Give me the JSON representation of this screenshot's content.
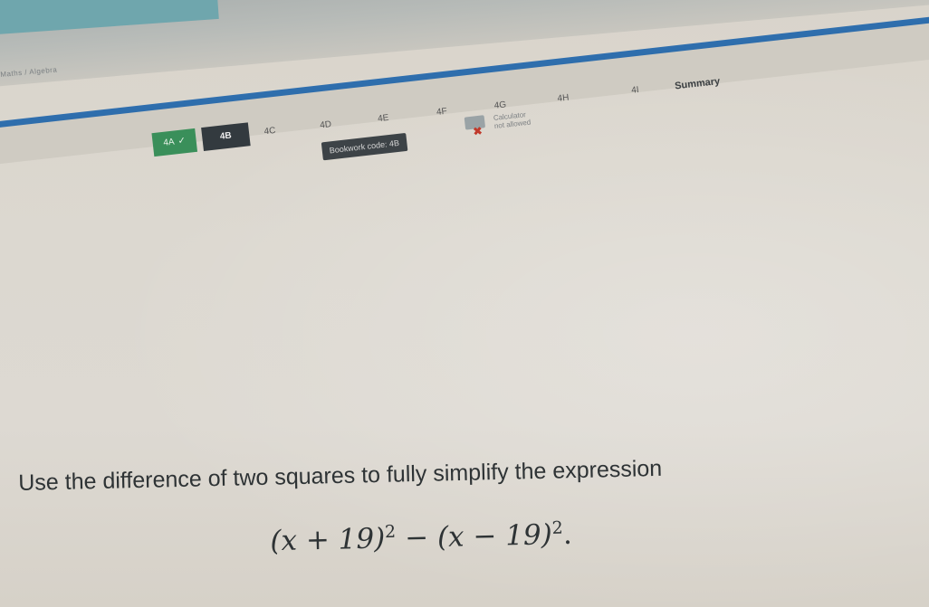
{
  "header": {
    "breadcrumb": "Maths / Algebra"
  },
  "tabs": [
    {
      "label": "4A",
      "state": "done",
      "check": "✓"
    },
    {
      "label": "4B",
      "state": "active"
    },
    {
      "label": "4C",
      "state": "pending"
    },
    {
      "label": "4D",
      "state": "pending"
    },
    {
      "label": "4E",
      "state": "pending"
    },
    {
      "label": "4F",
      "state": "pending"
    },
    {
      "label": "4G",
      "state": "pending"
    },
    {
      "label": "4H",
      "state": "pending"
    },
    {
      "label": "4I",
      "state": "pending"
    },
    {
      "label": "Summary",
      "state": "summary"
    }
  ],
  "toolbar": {
    "bookwork_label": "Bookwork code: 4B",
    "calculator_line1": "Calculator",
    "calculator_line2": "not allowed",
    "calculator_icon": "calculator-icon",
    "not_allowed_icon": "cross-icon"
  },
  "question": {
    "text": "Use the difference of two squares to fully simplify the expression",
    "expr_part1": "(x + 19)",
    "expr_exp1": "2",
    "expr_minus": "−",
    "expr_part2": "(x − 19)",
    "expr_exp2": "2",
    "expr_end": "."
  },
  "colors": {
    "tab_bar": "#2f6fae",
    "done_tab": "#3a8f5a",
    "active_tab": "#333a3f",
    "not_allowed": "#c0392b"
  }
}
